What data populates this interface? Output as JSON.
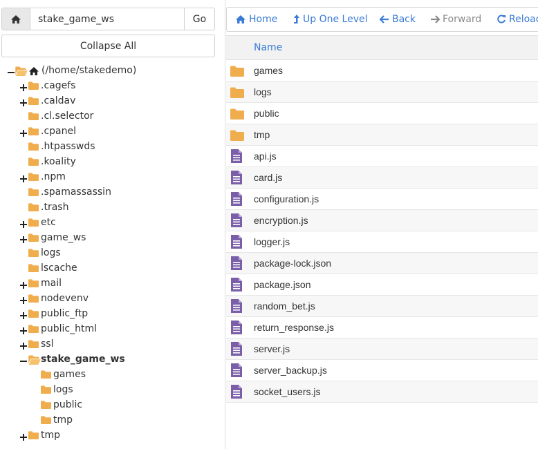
{
  "pathbar": {
    "home_icon": "home-icon",
    "path_value": "stake_game_ws",
    "go_label": "Go"
  },
  "collapse_label": "Collapse All",
  "tree": {
    "root_label": "(/home/stakedemo)",
    "items": [
      {
        "label": ".cagefs",
        "expandable": true
      },
      {
        "label": ".caldav",
        "expandable": true
      },
      {
        "label": ".cl.selector",
        "expandable": false
      },
      {
        "label": ".cpanel",
        "expandable": true
      },
      {
        "label": ".htpasswds",
        "expandable": false
      },
      {
        "label": ".koality",
        "expandable": false
      },
      {
        "label": ".npm",
        "expandable": true
      },
      {
        "label": ".spamassassin",
        "expandable": false
      },
      {
        "label": ".trash",
        "expandable": false
      },
      {
        "label": "etc",
        "expandable": true
      },
      {
        "label": "game_ws",
        "expandable": true
      },
      {
        "label": "logs",
        "expandable": false
      },
      {
        "label": "lscache",
        "expandable": false
      },
      {
        "label": "mail",
        "expandable": true
      },
      {
        "label": "nodevenv",
        "expandable": true
      },
      {
        "label": "public_ftp",
        "expandable": true
      },
      {
        "label": "public_html",
        "expandable": true
      },
      {
        "label": "ssl",
        "expandable": true
      },
      {
        "label": "stake_game_ws",
        "expandable": true,
        "expanded": true,
        "selected": true
      },
      {
        "label": "tmp",
        "expandable": true
      }
    ],
    "stake_children": [
      "games",
      "logs",
      "public",
      "tmp"
    ]
  },
  "toolbar": {
    "home": "Home",
    "up": "Up One Level",
    "back": "Back",
    "forward": "Forward",
    "reload": "Reload"
  },
  "list": {
    "header_name": "Name",
    "files": [
      {
        "name": "games",
        "type": "folder"
      },
      {
        "name": "logs",
        "type": "folder"
      },
      {
        "name": "public",
        "type": "folder"
      },
      {
        "name": "tmp",
        "type": "folder"
      },
      {
        "name": "api.js",
        "type": "file"
      },
      {
        "name": "card.js",
        "type": "file"
      },
      {
        "name": "configuration.js",
        "type": "file"
      },
      {
        "name": "encryption.js",
        "type": "file"
      },
      {
        "name": "logger.js",
        "type": "file"
      },
      {
        "name": "package-lock.json",
        "type": "file"
      },
      {
        "name": "package.json",
        "type": "file"
      },
      {
        "name": "random_bet.js",
        "type": "file"
      },
      {
        "name": "return_response.js",
        "type": "file"
      },
      {
        "name": "server.js",
        "type": "file"
      },
      {
        "name": "server_backup.js",
        "type": "file"
      },
      {
        "name": "socket_users.js",
        "type": "file"
      }
    ]
  },
  "colors": {
    "link": "#3a7bd5",
    "folder": "#f0ad4e",
    "file": "#7a5ea8",
    "disabled": "#8a8a8a"
  }
}
